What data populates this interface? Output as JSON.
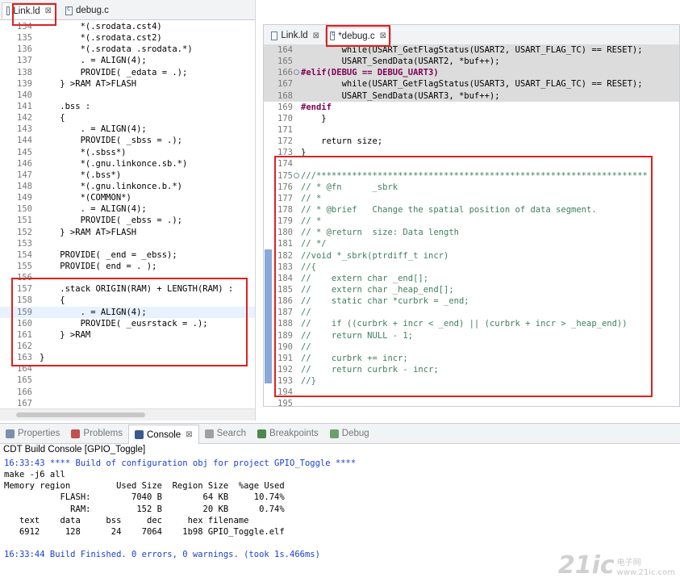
{
  "left_editor": {
    "tabs": [
      {
        "label": "Link.ld",
        "active": true,
        "close": "⊠"
      },
      {
        "label": "debug.c",
        "active": false,
        "close": ""
      }
    ],
    "lines": [
      {
        "n": "134",
        "code": "        *(.srodata.cst4)"
      },
      {
        "n": "135",
        "code": "        *(.srodata.cst2)"
      },
      {
        "n": "136",
        "code": "        *(.srodata .srodata.*)"
      },
      {
        "n": "137",
        "code": "        . = ALIGN(4);"
      },
      {
        "n": "138",
        "code": "        PROVIDE( _edata = .);"
      },
      {
        "n": "139",
        "code": "    } >RAM AT>FLASH"
      },
      {
        "n": "140",
        "code": ""
      },
      {
        "n": "141",
        "code": "    .bss :"
      },
      {
        "n": "142",
        "code": "    {"
      },
      {
        "n": "143",
        "code": "        . = ALIGN(4);"
      },
      {
        "n": "144",
        "code": "        PROVIDE( _sbss = .);"
      },
      {
        "n": "145",
        "code": "        *(.sbss*)"
      },
      {
        "n": "146",
        "code": "        *(.gnu.linkonce.sb.*)"
      },
      {
        "n": "147",
        "code": "        *(.bss*)"
      },
      {
        "n": "148",
        "code": "        *(.gnu.linkonce.b.*)"
      },
      {
        "n": "149",
        "code": "        *(COMMON*)"
      },
      {
        "n": "150",
        "code": "        . = ALIGN(4);"
      },
      {
        "n": "151",
        "code": "        PROVIDE( _ebss = .);"
      },
      {
        "n": "152",
        "code": "    } >RAM AT>FLASH"
      },
      {
        "n": "153",
        "code": ""
      },
      {
        "n": "154",
        "code": "    PROVIDE( _end = _ebss);"
      },
      {
        "n": "155",
        "code": "    PROVIDE( end = . );"
      },
      {
        "n": "156",
        "code": ""
      },
      {
        "n": "157",
        "code": "    .stack ORIGIN(RAM) + LENGTH(RAM) :"
      },
      {
        "n": "158",
        "code": "    {"
      },
      {
        "n": "159",
        "code": "        . = ALIGN(4);",
        "hl": true
      },
      {
        "n": "160",
        "code": "        PROVIDE( _eusrstack = .);"
      },
      {
        "n": "161",
        "code": "    } >RAM"
      },
      {
        "n": "162",
        "code": ""
      },
      {
        "n": "163",
        "code": "}"
      },
      {
        "n": "164",
        "code": ""
      },
      {
        "n": "165",
        "code": ""
      },
      {
        "n": "166",
        "code": ""
      },
      {
        "n": "167",
        "code": ""
      }
    ]
  },
  "right_editor": {
    "tabs": [
      {
        "label": "Link.ld",
        "active": false,
        "close": "⊠"
      },
      {
        "label": "*debug.c",
        "active": true,
        "close": "⊠"
      }
    ],
    "lines": [
      {
        "n": "164",
        "code": "        while(USART_GetFlagStatus(USART2, USART_FLAG_TC) == RESET);",
        "gray": true
      },
      {
        "n": "165",
        "code": "        USART_SendData(USART2, *buf++);",
        "gray": true
      },
      {
        "n": "166",
        "code": "#elif(DEBUG == DEBUG_UART3)",
        "gray": true,
        "fold": true
      },
      {
        "n": "167",
        "code": "        while(USART_GetFlagStatus(USART3, USART_FLAG_TC) == RESET);",
        "gray": true
      },
      {
        "n": "168",
        "code": "        USART_SendData(USART3, *buf++);",
        "gray": true
      },
      {
        "n": "169",
        "code": "#endif"
      },
      {
        "n": "170",
        "code": "    }"
      },
      {
        "n": "171",
        "code": ""
      },
      {
        "n": "172",
        "code": "    return size;"
      },
      {
        "n": "173",
        "code": "}"
      },
      {
        "n": "174",
        "code": ""
      },
      {
        "n": "175",
        "code": "///*****************************************************************",
        "fold": true
      },
      {
        "n": "176",
        "code": "// * @fn      _sbrk"
      },
      {
        "n": "177",
        "code": "// *"
      },
      {
        "n": "178",
        "code": "// * @brief   Change the spatial position of data segment."
      },
      {
        "n": "179",
        "code": "// *"
      },
      {
        "n": "180",
        "code": "// * @return  size: Data length"
      },
      {
        "n": "181",
        "code": "// */"
      },
      {
        "n": "182",
        "code": "//void *_sbrk(ptrdiff_t incr)"
      },
      {
        "n": "183",
        "code": "//{"
      },
      {
        "n": "184",
        "code": "//    extern char _end[];"
      },
      {
        "n": "185",
        "code": "//    extern char _heap_end[];"
      },
      {
        "n": "186",
        "code": "//    static char *curbrk = _end;"
      },
      {
        "n": "187",
        "code": "//"
      },
      {
        "n": "188",
        "code": "//    if ((curbrk + incr < _end) || (curbrk + incr > _heap_end))"
      },
      {
        "n": "189",
        "code": "//    return NULL - 1;"
      },
      {
        "n": "190",
        "code": "//"
      },
      {
        "n": "191",
        "code": "//    curbrk += incr;"
      },
      {
        "n": "192",
        "code": "//    return curbrk - incr;"
      },
      {
        "n": "193",
        "code": "//}"
      },
      {
        "n": "194",
        "code": ""
      },
      {
        "n": "195",
        "code": ""
      }
    ]
  },
  "panel": {
    "tabs": [
      {
        "label": "Properties",
        "icon": "properties-icon",
        "color": "#7a8fb0",
        "active": false
      },
      {
        "label": "Problems",
        "icon": "problems-icon",
        "color": "#c0504d",
        "active": false
      },
      {
        "label": "Console",
        "icon": "console-icon",
        "color": "#3a5a8a",
        "active": true,
        "close": "⊠"
      },
      {
        "label": "Search",
        "icon": "search-icon",
        "color": "#a0a0a0",
        "active": false
      },
      {
        "label": "Breakpoints",
        "icon": "breakpoints-icon",
        "color": "#4a8a4a",
        "active": false
      },
      {
        "label": "Debug",
        "icon": "debug-icon",
        "color": "#6aa06a",
        "active": false
      }
    ],
    "console_title": "CDT Build Console [GPIO_Toggle]",
    "output": [
      {
        "text": "16:33:43 **** Build of configuration obj for project GPIO_Toggle ****",
        "blue": true
      },
      {
        "text": "make -j6 all",
        "blue": false
      },
      {
        "text": "Memory region         Used Size  Region Size  %age Used",
        "blue": false
      },
      {
        "text": "           FLASH:        7040 B        64 KB     10.74%",
        "blue": false
      },
      {
        "text": "             RAM:         152 B        20 KB      0.74%",
        "blue": false
      },
      {
        "text": "   text    data     bss     dec     hex filename",
        "blue": false
      },
      {
        "text": "   6912     128      24    7064    1b98 GPIO_Toggle.elf",
        "blue": false
      },
      {
        "text": "",
        "blue": false
      },
      {
        "text": "16:33:44 Build Finished. 0 errors, 0 warnings. (took 1s.466ms)",
        "blue": true
      }
    ]
  },
  "watermark": {
    "big": "21ic",
    "line1": "电子网",
    "line2": "www.21ic.com"
  }
}
